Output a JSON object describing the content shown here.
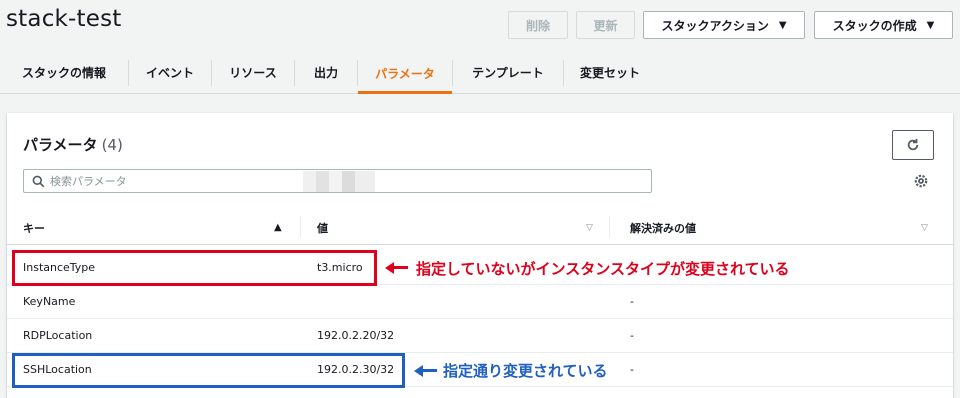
{
  "header": {
    "title": "stack-test",
    "buttons": {
      "delete": "削除",
      "update": "更新",
      "stack_actions": "スタックアクション",
      "create_stack": "スタックの作成"
    }
  },
  "tabs": [
    {
      "label": "スタックの情報"
    },
    {
      "label": "イベント"
    },
    {
      "label": "リソース"
    },
    {
      "label": "出力"
    },
    {
      "label": "パラメータ",
      "active": true
    },
    {
      "label": "テンプレート"
    },
    {
      "label": "変更セット"
    }
  ],
  "panel": {
    "title": "パラメータ",
    "count": "(4)",
    "search_placeholder": "検索パラメータ"
  },
  "table": {
    "columns": [
      "キー",
      "値",
      "解決済みの値"
    ],
    "rows": [
      {
        "key": "InstanceType",
        "value": "t3.micro",
        "resolved": ""
      },
      {
        "key": "KeyName",
        "value": "",
        "resolved": "-"
      },
      {
        "key": "RDPLocation",
        "value": "192.0.2.20/32",
        "resolved": "-"
      },
      {
        "key": "SSHLocation",
        "value": "192.0.2.30/32",
        "resolved": "-"
      }
    ]
  },
  "annotations": {
    "red_note": "指定していないがインスタンスタイプが変更されている",
    "blue_note": "指定通り変更されている",
    "red_color": "#e0001b",
    "blue_color": "#1f5fbf"
  },
  "colors": {
    "accent": "#ec7211",
    "background": "#f2f3f3"
  }
}
